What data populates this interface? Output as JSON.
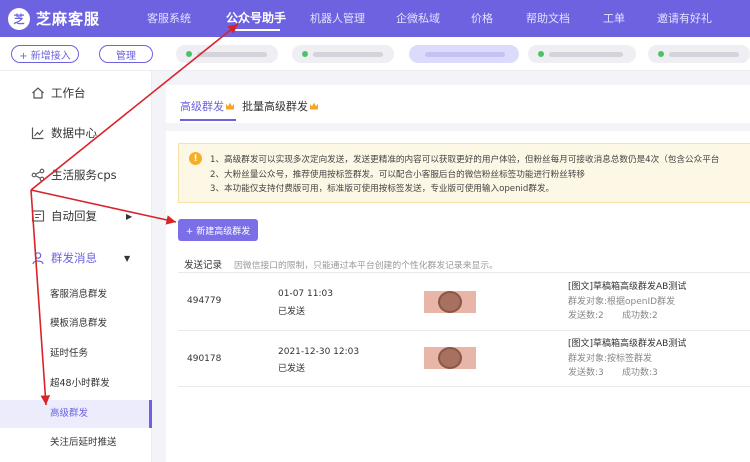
{
  "topbar": {
    "brand_icon": "芝",
    "brand_name": "芝麻客服",
    "nav": [
      "客服系统",
      "公众号助手",
      "机器人管理",
      "企微私域",
      "价格",
      "帮助文档",
      "工单",
      "邀请有好礼"
    ],
    "active_nav": 1
  },
  "subbar": {
    "add_label": "+ 新增接入",
    "manage_label": "管理"
  },
  "sidebar": {
    "items": [
      {
        "label": "工作台",
        "icon": "home-icon"
      },
      {
        "label": "数据中心",
        "icon": "chart-icon"
      },
      {
        "label": "生活服务cps",
        "icon": "share-icon"
      },
      {
        "label": "自动回复",
        "icon": "reply-icon"
      },
      {
        "label": "群发消息",
        "icon": "user-icon"
      }
    ],
    "sub_items": [
      "客服消息群发",
      "模板消息群发",
      "延时任务",
      "超48小时群发",
      "高级群发",
      "关注后延时推送"
    ],
    "active_sub": 4
  },
  "tabs": [
    "高级群发",
    "批量高级群发"
  ],
  "notice": {
    "lines": [
      "1、高级群发可以实现多次定向发送，发送更精准的内容可以获取更好的用户体验，但粉丝每月可接收消息总数仍是4次（包含公众平台",
      "2、大粉丝量公众号，推荐使用按标签群发。可以配合小客服后台的微信粉丝标签功能进行粉丝转移",
      "3、本功能仅支持付费版可用，标准版可使用按标签发送，专业版可使用输入openid群发。"
    ]
  },
  "new_button": "+ 新建高级群发",
  "records": {
    "title": "发送记录",
    "note": "因微信接口的限制，只能通过本平台创建的个性化群发记录来显示。",
    "rows": [
      {
        "id": "494779",
        "time": "01-07 11:03",
        "status": "已发送",
        "title": "[图文]草稿箱高级群发AB测试",
        "target": "群发对象:根据openID群发",
        "sent": "发送数:2",
        "success": "成功数:2"
      },
      {
        "id": "490178",
        "time": "2021-12-30 12:03",
        "status": "已发送",
        "title": "[图文]草稿箱高级群发AB测试",
        "target": "群发对象:按标签群发",
        "sent": "发送数:3",
        "success": "成功数:3"
      }
    ]
  },
  "colors": {
    "accent": "#6d63e0",
    "annotation": "#d9232a",
    "notice_bg": "#fdf8e6"
  }
}
